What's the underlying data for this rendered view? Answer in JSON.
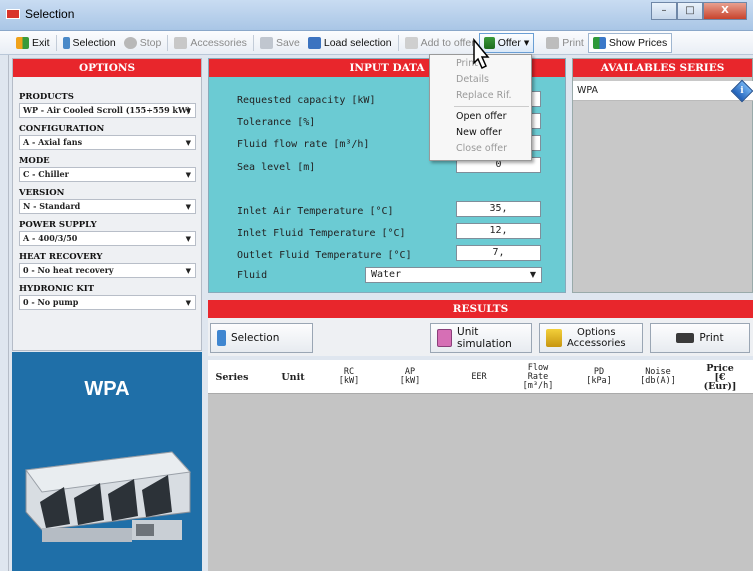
{
  "window": {
    "title": "Selection",
    "controls": [
      "–",
      "□",
      "X"
    ]
  },
  "toolbar": {
    "exit": "Exit",
    "selection": "Selection",
    "stop": "Stop",
    "accessories": "Accessories",
    "save": "Save",
    "load_selection": "Load selection",
    "add_to_offer": "Add to offer",
    "offer": "Offer",
    "print": "Print",
    "show_prices": "Show Prices"
  },
  "options": {
    "header": "OPTIONS",
    "products_label": "PRODUCTS",
    "products_value": "WP - Air Cooled Scroll (155÷559 kW)",
    "configuration_label": "CONFIGURATION",
    "configuration_value": "A - Axial fans",
    "mode_label": "MODE",
    "mode_value": "C - Chiller",
    "version_label": "VERSION",
    "version_value": "N - Standard",
    "power_label": "POWER SUPPLY",
    "power_value": "A - 400/3/50",
    "heat_label": "HEAT RECOVERY",
    "heat_value": "0 - No heat recovery",
    "hydronic_label": "HYDRONIC KIT",
    "hydronic_value": "0 - No pump"
  },
  "input": {
    "header": "INPUT DATA",
    "capacity_label": "Requested capacity [kW]",
    "tolerance_label": "Tolerance [%]",
    "flow_label": "Fluid flow rate [m³/h]",
    "sea_label": "Sea level [m]",
    "sea_value": "0",
    "air_temp_label": "Inlet Air Temperature [°C]",
    "air_temp_value": "35,",
    "inlet_fluid_label": "Inlet Fluid Temperature [°C]",
    "inlet_fluid_value": "12,",
    "outlet_fluid_label": "Outlet Fluid Temperature [°C]",
    "outlet_fluid_value": "7,",
    "fluid_label": "Fluid",
    "fluid_value": "Water"
  },
  "series": {
    "header": "AVAILABLES SERIES",
    "items": [
      "WPA"
    ]
  },
  "offer_menu": {
    "items": [
      "Print",
      "Details",
      "Replace Rif.",
      "Open offer",
      "New offer",
      "Close offer"
    ]
  },
  "results": {
    "header": "RESULTS",
    "selection": "Selection",
    "unit_simulation": "Unit simulation",
    "options_line1": "Options",
    "options_line2": "Accessories",
    "print": "Print",
    "columns": [
      {
        "l1": "Series",
        "l2": "",
        "l3": ""
      },
      {
        "l1": "Unit",
        "l2": "",
        "l3": ""
      },
      {
        "l1": "RC",
        "l2": "[kW]",
        "l3": ""
      },
      {
        "l1": "AP",
        "l2": "[kW]",
        "l3": ""
      },
      {
        "l1": "EER",
        "l2": "",
        "l3": ""
      },
      {
        "l1": "Flow",
        "l2": "Rate",
        "l3": "[m³/h]"
      },
      {
        "l1": "PD",
        "l2": "[kPa]",
        "l3": ""
      },
      {
        "l1": "Noise",
        "l2": "[db(A)]",
        "l3": ""
      },
      {
        "l1": "Price",
        "l2": "[€",
        "l3": "(Eur)]"
      }
    ]
  },
  "product_image": {
    "title": "WPA"
  },
  "colors": {
    "red_header": "#e8262c",
    "input_bg": "#6bcbd3",
    "product_bg": "#1f6fa8"
  }
}
